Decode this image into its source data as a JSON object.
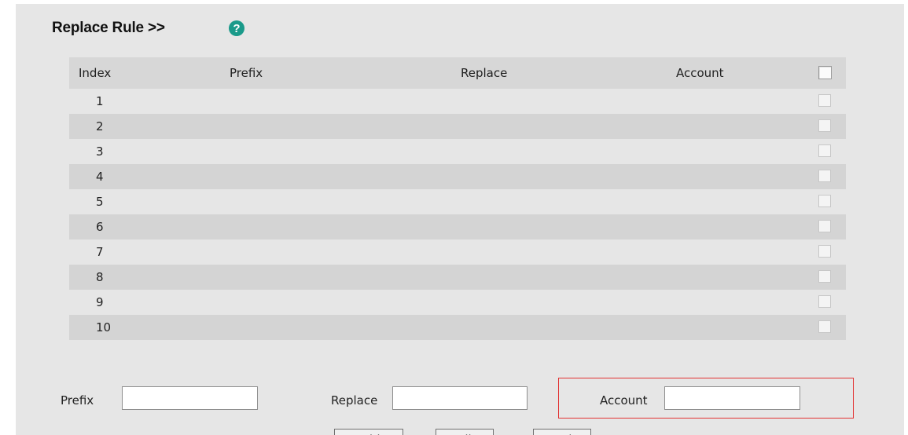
{
  "header": {
    "title": "Replace Rule >>",
    "help_icon": "question-circle-icon"
  },
  "table": {
    "columns": {
      "index": "Index",
      "prefix": "Prefix",
      "replace": "Replace",
      "account": "Account"
    },
    "rows": [
      {
        "index": "1",
        "prefix": "",
        "replace": "",
        "account": ""
      },
      {
        "index": "2",
        "prefix": "",
        "replace": "",
        "account": ""
      },
      {
        "index": "3",
        "prefix": "",
        "replace": "",
        "account": ""
      },
      {
        "index": "4",
        "prefix": "",
        "replace": "",
        "account": ""
      },
      {
        "index": "5",
        "prefix": "",
        "replace": "",
        "account": ""
      },
      {
        "index": "6",
        "prefix": "",
        "replace": "",
        "account": ""
      },
      {
        "index": "7",
        "prefix": "",
        "replace": "",
        "account": ""
      },
      {
        "index": "8",
        "prefix": "",
        "replace": "",
        "account": ""
      },
      {
        "index": "9",
        "prefix": "",
        "replace": "",
        "account": ""
      },
      {
        "index": "10",
        "prefix": "",
        "replace": "",
        "account": ""
      }
    ]
  },
  "form": {
    "prefix_label": "Prefix",
    "prefix_value": "",
    "replace_label": "Replace",
    "replace_value": "",
    "account_label": "Account",
    "account_value": ""
  },
  "buttons": {
    "add": "Add",
    "edit": "Edit",
    "del": "Del"
  },
  "colors": {
    "help_icon": "#1a9a8a",
    "highlight_border": "#e23232",
    "row_shade": "#d4d4d4"
  }
}
